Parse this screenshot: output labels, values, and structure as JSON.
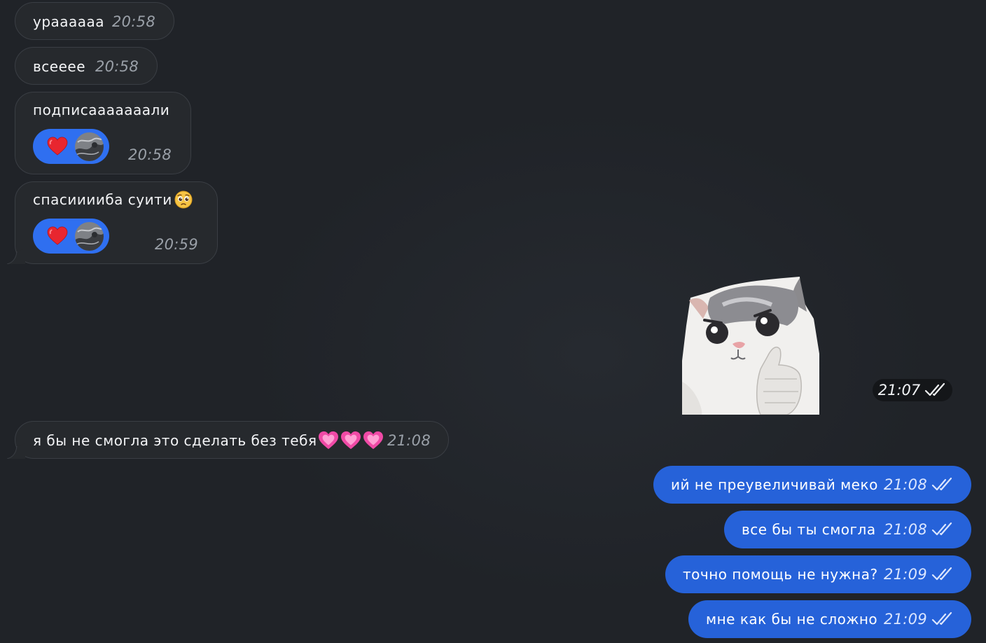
{
  "incoming": [
    {
      "text": "ураааааа",
      "time": "20:58"
    },
    {
      "text": "всеееe",
      "time": "20:58"
    },
    {
      "text": "подписааааааали",
      "time": "20:58",
      "reaction": "heart-emoji"
    },
    {
      "text": "спасиииибa суити",
      "time": "20:59",
      "reaction": "heart-emoji",
      "emoji": "pleading-face-emoji"
    },
    {
      "text": "я бы не смогла это сделать без тебя",
      "time": "21:08",
      "emoji": "sparkling-heart-emoji"
    }
  ],
  "sticker": {
    "icon": "cat-thumbs-up-sticker",
    "time": "21:07"
  },
  "outgoing": [
    {
      "text": "ий не преувеличивай меко",
      "time": "21:08"
    },
    {
      "text": "все бы ты смогла",
      "time": "21:08"
    },
    {
      "text": "точно помощь не нужна?",
      "time": "21:09"
    },
    {
      "text": "мне как бы не сложно",
      "time": "21:09"
    }
  ],
  "colors": {
    "background": "#22252a",
    "incoming_bubble": "#26292d",
    "outgoing_bubble": "#2662d9",
    "reaction": "#2f6ff0"
  }
}
